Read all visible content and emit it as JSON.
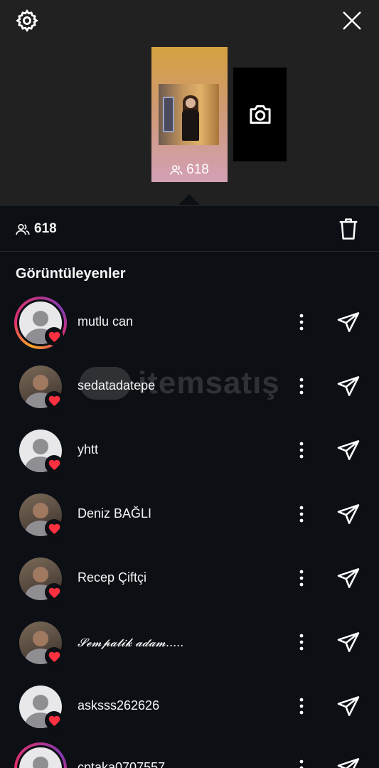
{
  "story": {
    "view_count": "618",
    "icons": {
      "settings": "gear-icon",
      "close": "close-icon",
      "camera": "camera-icon",
      "viewers": "people-icon",
      "delete": "trash-icon"
    }
  },
  "stats": {
    "view_count": "618"
  },
  "viewers_section": {
    "title": "Görüntüleyenler"
  },
  "viewers": [
    {
      "username": "mutlu can",
      "avatar": "default",
      "ring": true,
      "liked": true
    },
    {
      "username": "sedatadatepe",
      "avatar": "photo",
      "ring": false,
      "liked": true
    },
    {
      "username": "yhtt",
      "avatar": "default",
      "ring": false,
      "liked": true
    },
    {
      "username": "Deniz BAĞLI",
      "avatar": "photo",
      "ring": false,
      "liked": true
    },
    {
      "username": "Recep Çiftçi",
      "avatar": "photo",
      "ring": false,
      "liked": true
    },
    {
      "username": "𝓢𝓮𝓶𝓹𝓪𝓽𝓲𝓴 𝓪𝓭𝓪𝓶.....",
      "avatar": "photo",
      "ring": false,
      "liked": true
    },
    {
      "username": "asksss262626",
      "avatar": "default",
      "ring": false,
      "liked": true
    },
    {
      "username": "cptaka0707557",
      "avatar": "default",
      "ring": true,
      "liked": false
    }
  ],
  "watermark": {
    "text": "itemsatış"
  },
  "colors": {
    "background": "#0c0f14",
    "top_area": "#212121",
    "heart": "#ff3040",
    "text": "#f5f5f5"
  }
}
